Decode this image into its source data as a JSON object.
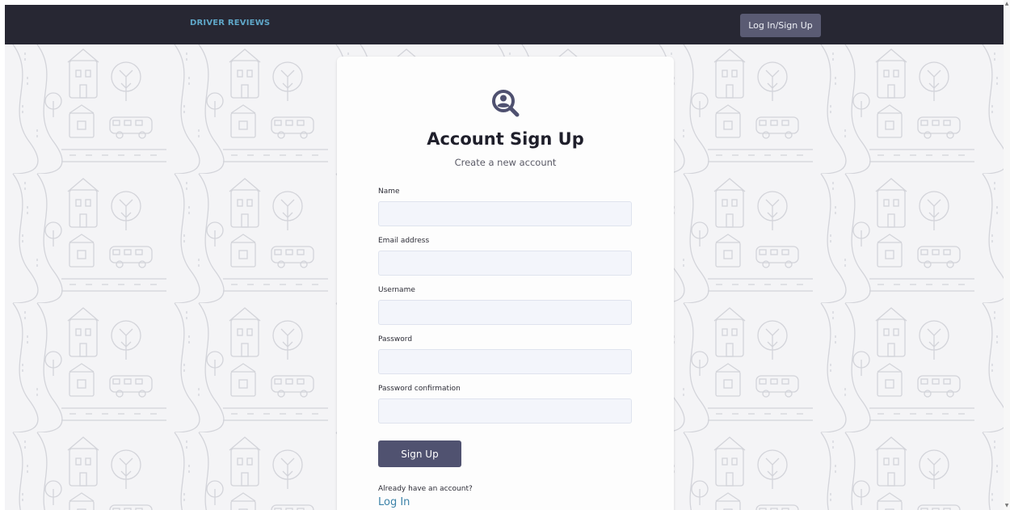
{
  "navbar": {
    "brand": "DRIVER REVIEWS",
    "login_button": "Log In/Sign Up"
  },
  "card": {
    "logo_icon": "magnifier-user-icon",
    "title": "Account Sign Up",
    "subtitle": "Create a new account",
    "fields": [
      {
        "label": "Name",
        "value": "",
        "placeholder": ""
      },
      {
        "label": "Email address",
        "value": "",
        "placeholder": ""
      },
      {
        "label": "Username",
        "value": "",
        "placeholder": ""
      },
      {
        "label": "Password",
        "value": "",
        "placeholder": ""
      },
      {
        "label": "Password confirmation",
        "value": "",
        "placeholder": ""
      }
    ],
    "submit_label": "Sign Up",
    "already_text": "Already have an account?",
    "login_link": "Log In"
  },
  "colors": {
    "navbar": "#272733",
    "accent": "#505270",
    "link": "#3b82a8",
    "brand": "#5fa7c8"
  }
}
